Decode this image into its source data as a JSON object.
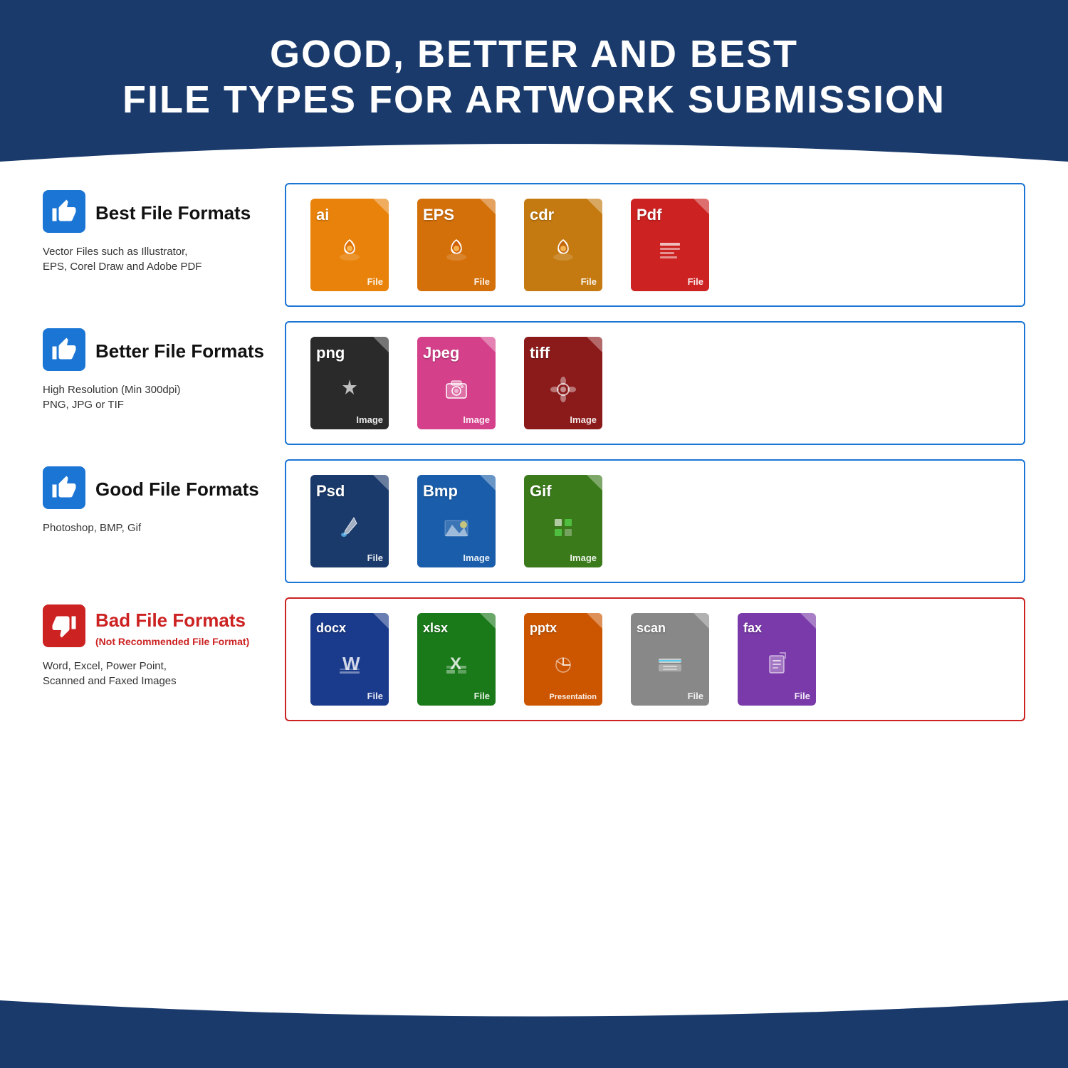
{
  "header": {
    "title_line1": "GOOD, BETTER AND BEST",
    "title_line2": "FILE TYPES FOR ARTWORK SUBMISSION"
  },
  "sections": [
    {
      "id": "best",
      "thumbs": "up",
      "title": "Best File Formats",
      "subtitle": "",
      "description": "Vector Files such as Illustrator,\nEPS, Corel Draw and Adobe PDF",
      "border_color": "#1a75d4",
      "files": [
        {
          "ext": "ai",
          "label": "File",
          "color": "#e8820a",
          "icon": "pen"
        },
        {
          "ext": "EPS",
          "label": "File",
          "color": "#d4700a",
          "icon": "pen"
        },
        {
          "ext": "cdr",
          "label": "File",
          "color": "#c47a10",
          "icon": "pen"
        },
        {
          "ext": "Pdf",
          "label": "File",
          "color": "#cc2222",
          "icon": "doc"
        }
      ]
    },
    {
      "id": "better",
      "thumbs": "up",
      "title": "Better File Formats",
      "subtitle": "",
      "description": "High Resolution (Min 300dpi)\nPNG, JPG or TIF",
      "border_color": "#1a75d4",
      "files": [
        {
          "ext": "png",
          "label": "Image",
          "color": "#2a2a2a",
          "icon": "star"
        },
        {
          "ext": "Jpeg",
          "label": "Image",
          "color": "#d4408a",
          "icon": "camera"
        },
        {
          "ext": "tiff",
          "label": "Image",
          "color": "#8b1a1a",
          "icon": "flower"
        }
      ]
    },
    {
      "id": "good",
      "thumbs": "up",
      "title": "Good File Formats",
      "subtitle": "",
      "description": "Photoshop, BMP, Gif",
      "border_color": "#1a75d4",
      "files": [
        {
          "ext": "Psd",
          "label": "File",
          "color": "#1a3a6b",
          "icon": "brush"
        },
        {
          "ext": "Bmp",
          "label": "Image",
          "color": "#1a5daa",
          "icon": "mountain"
        },
        {
          "ext": "Gif",
          "label": "Image",
          "color": "#3a7a1a",
          "icon": "grid"
        }
      ]
    },
    {
      "id": "bad",
      "thumbs": "down",
      "title": "Bad File Formats",
      "subtitle": "(Not Recommended File Format)",
      "description": "Word, Excel, Power Point,\nScanned and Faxed Images",
      "border_color": "#cc2222",
      "files": [
        {
          "ext": "docx",
          "label": "File",
          "color": "#1a3a8b",
          "icon": "word"
        },
        {
          "ext": "xlsx",
          "label": "File",
          "color": "#1a7a1a",
          "icon": "excel"
        },
        {
          "ext": "pptx",
          "label": "Presentation",
          "color": "#cc5500",
          "icon": "ppt"
        },
        {
          "ext": "scan",
          "label": "File",
          "color": "#888",
          "icon": "scan"
        },
        {
          "ext": "fax",
          "label": "File",
          "color": "#7a3aaa",
          "icon": "fax"
        }
      ]
    }
  ]
}
